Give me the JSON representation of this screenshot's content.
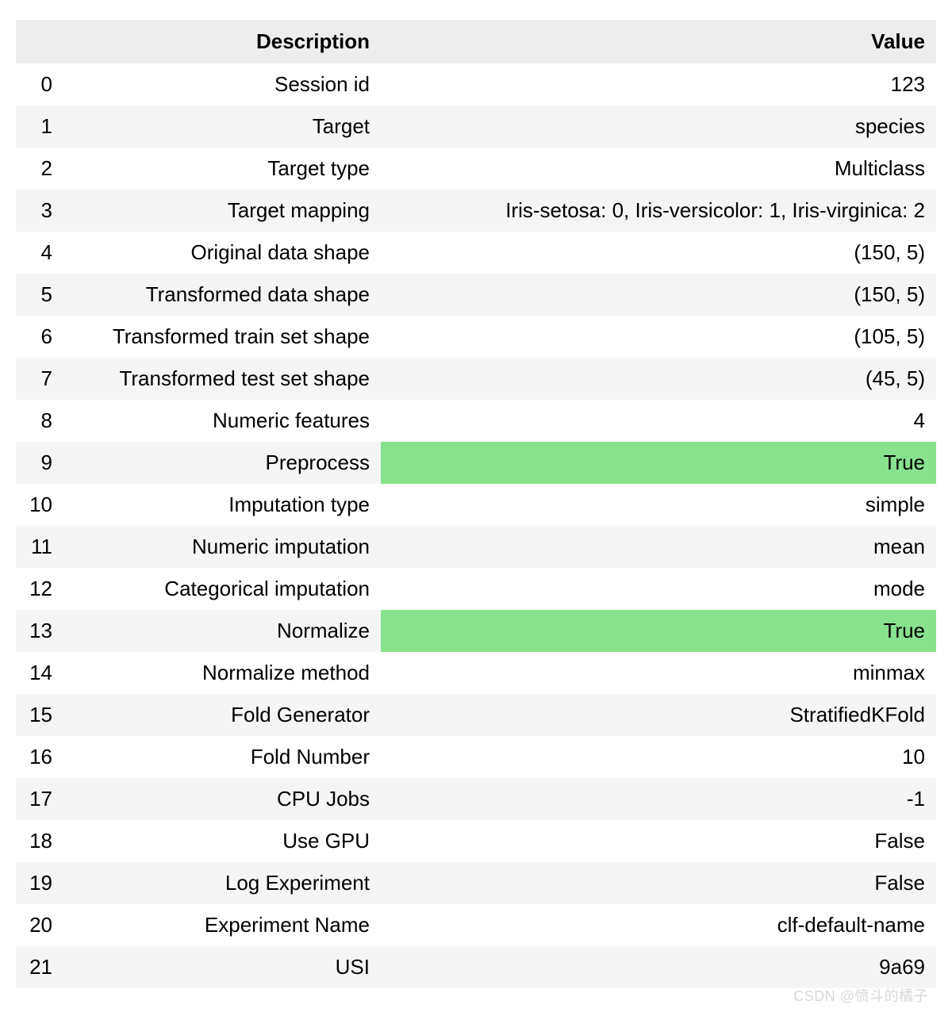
{
  "headers": {
    "index": "",
    "description": "Description",
    "value": "Value"
  },
  "rows": [
    {
      "idx": "0",
      "description": "Session id",
      "value": "123",
      "highlight": false
    },
    {
      "idx": "1",
      "description": "Target",
      "value": "species",
      "highlight": false
    },
    {
      "idx": "2",
      "description": "Target type",
      "value": "Multiclass",
      "highlight": false
    },
    {
      "idx": "3",
      "description": "Target mapping",
      "value": "Iris-setosa: 0, Iris-versicolor: 1, Iris-virginica: 2",
      "highlight": false
    },
    {
      "idx": "4",
      "description": "Original data shape",
      "value": "(150, 5)",
      "highlight": false
    },
    {
      "idx": "5",
      "description": "Transformed data shape",
      "value": "(150, 5)",
      "highlight": false
    },
    {
      "idx": "6",
      "description": "Transformed train set shape",
      "value": "(105, 5)",
      "highlight": false
    },
    {
      "idx": "7",
      "description": "Transformed test set shape",
      "value": "(45, 5)",
      "highlight": false
    },
    {
      "idx": "8",
      "description": "Numeric features",
      "value": "4",
      "highlight": false
    },
    {
      "idx": "9",
      "description": "Preprocess",
      "value": "True",
      "highlight": true
    },
    {
      "idx": "10",
      "description": "Imputation type",
      "value": "simple",
      "highlight": false
    },
    {
      "idx": "11",
      "description": "Numeric imputation",
      "value": "mean",
      "highlight": false
    },
    {
      "idx": "12",
      "description": "Categorical imputation",
      "value": "mode",
      "highlight": false
    },
    {
      "idx": "13",
      "description": "Normalize",
      "value": "True",
      "highlight": true
    },
    {
      "idx": "14",
      "description": "Normalize method",
      "value": "minmax",
      "highlight": false
    },
    {
      "idx": "15",
      "description": "Fold Generator",
      "value": "StratifiedKFold",
      "highlight": false
    },
    {
      "idx": "16",
      "description": "Fold Number",
      "value": "10",
      "highlight": false
    },
    {
      "idx": "17",
      "description": "CPU Jobs",
      "value": "-1",
      "highlight": false
    },
    {
      "idx": "18",
      "description": "Use GPU",
      "value": "False",
      "highlight": false
    },
    {
      "idx": "19",
      "description": "Log Experiment",
      "value": "False",
      "highlight": false
    },
    {
      "idx": "20",
      "description": "Experiment Name",
      "value": "clf-default-name",
      "highlight": false
    },
    {
      "idx": "21",
      "description": "USI",
      "value": "9a69",
      "highlight": false
    }
  ],
  "watermark": "CSDN @愤斗的橘子"
}
